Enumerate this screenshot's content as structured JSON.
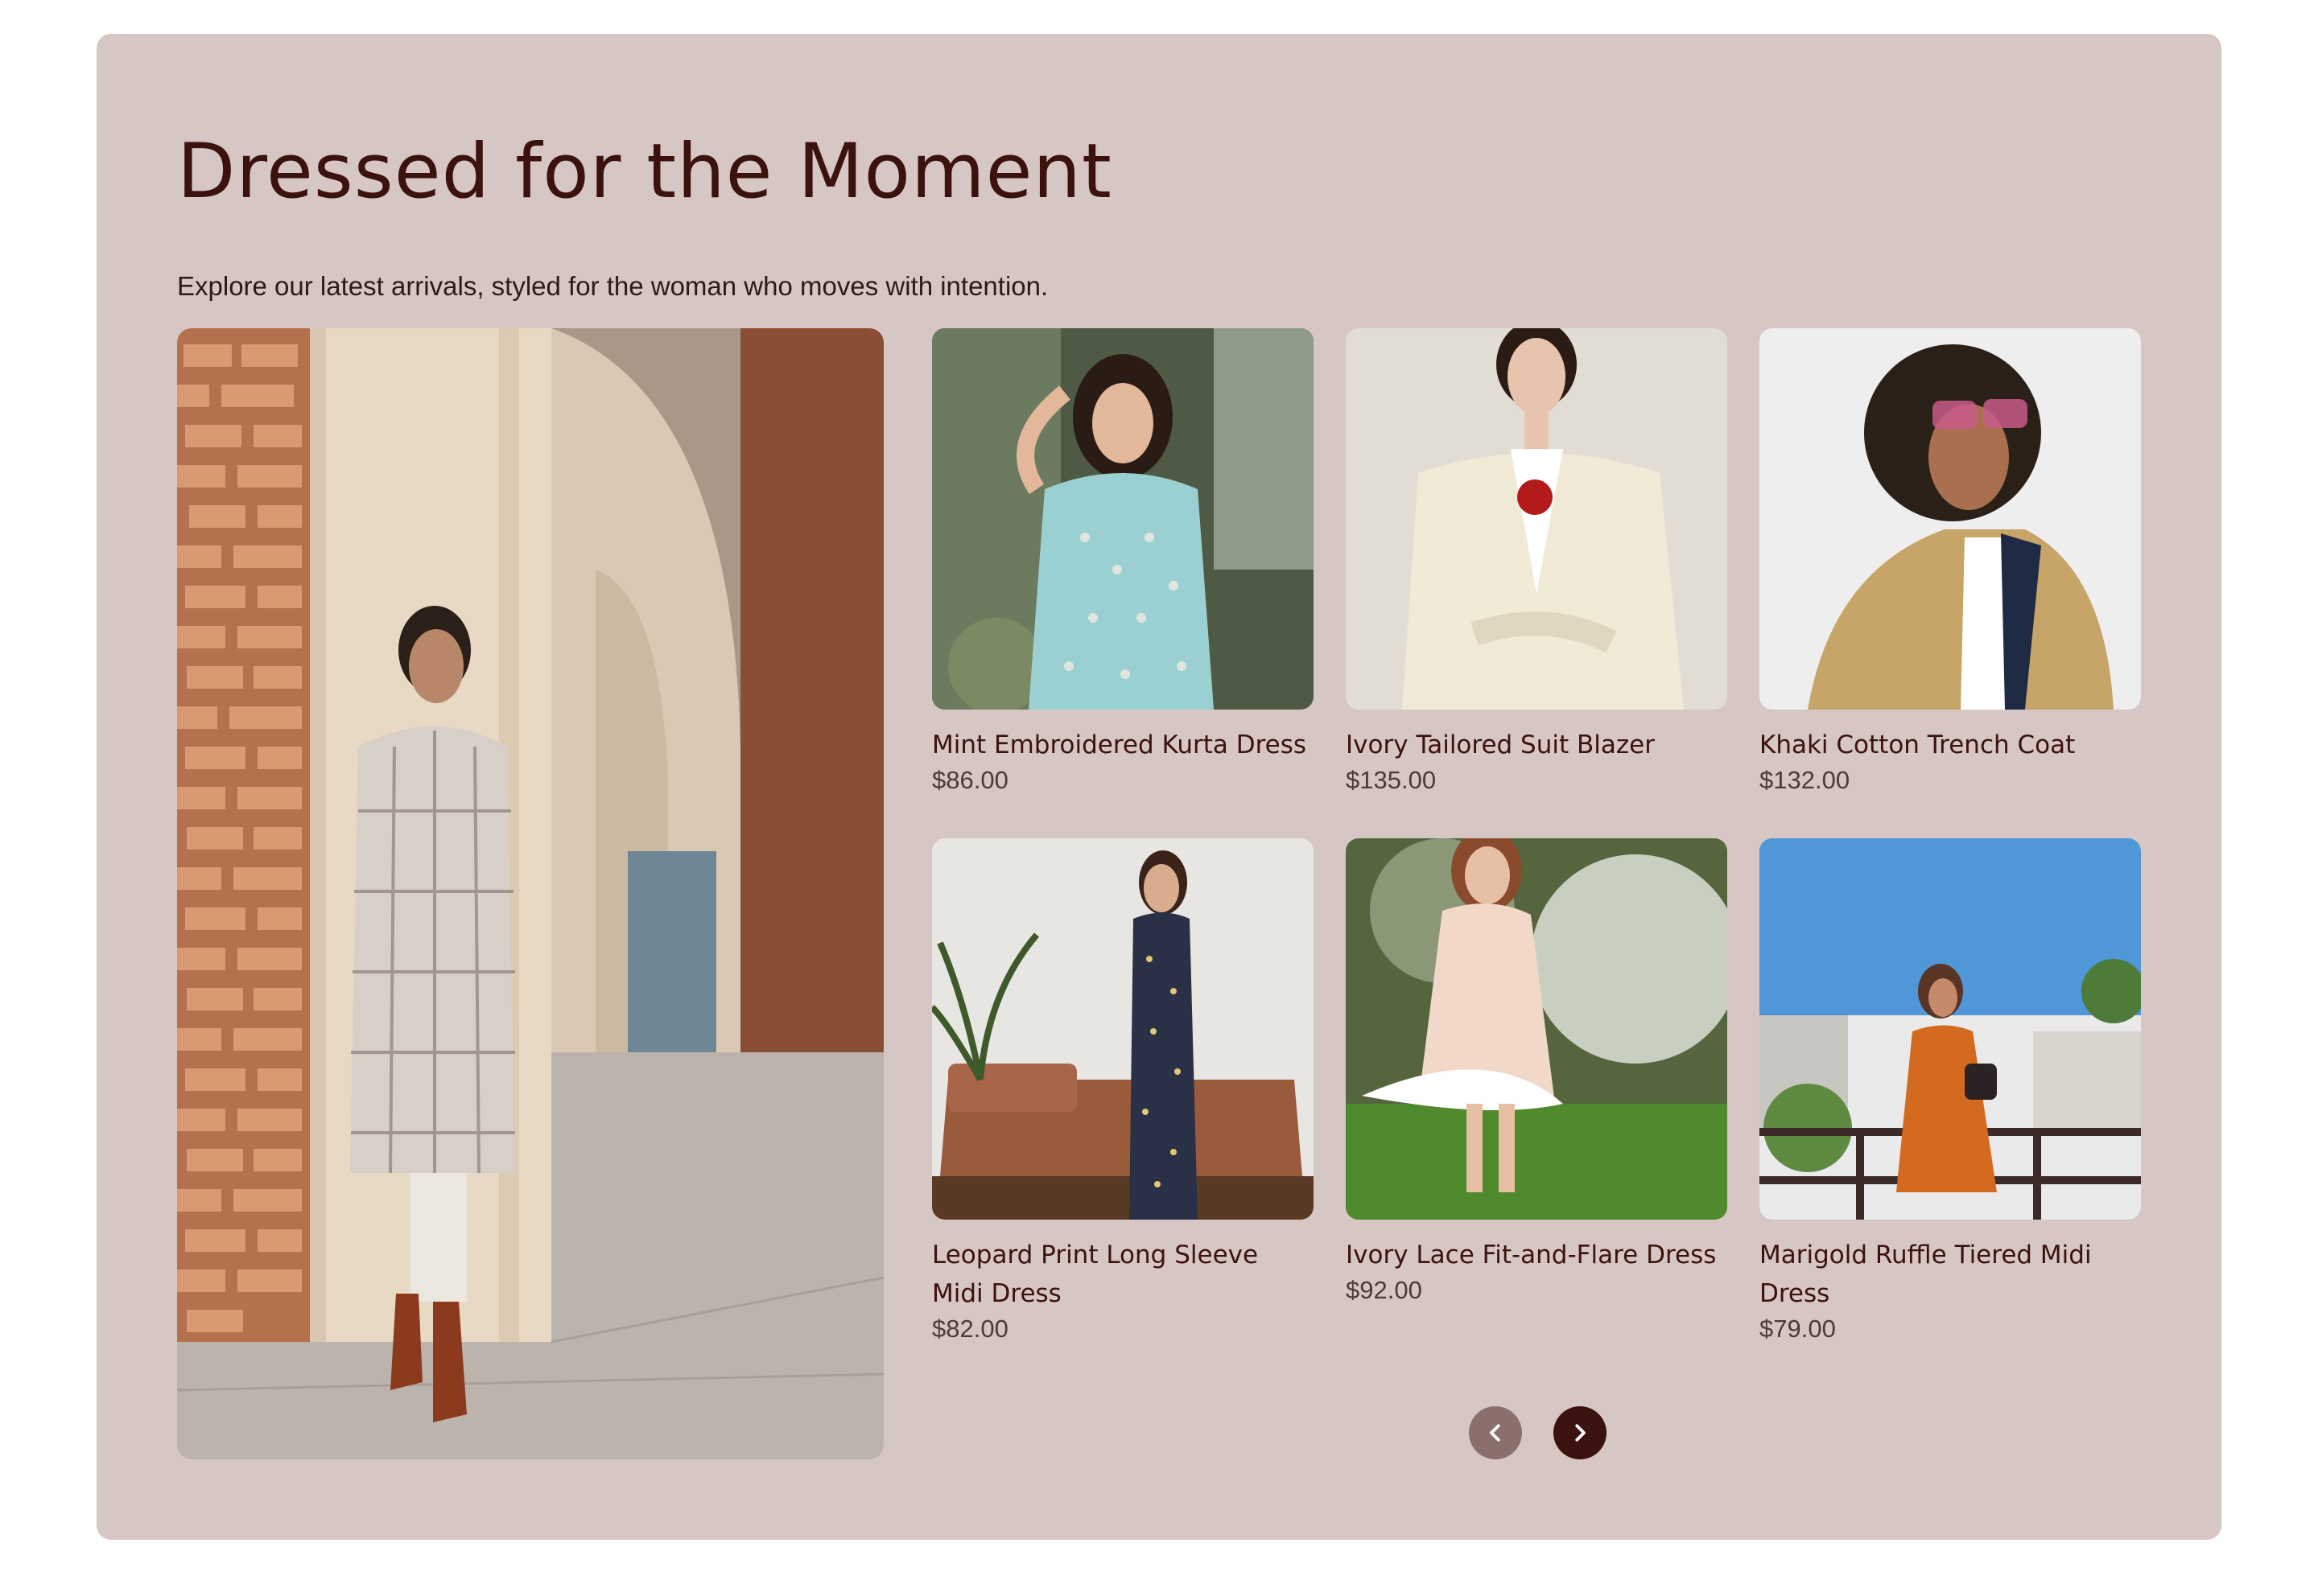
{
  "section": {
    "title": "Dressed for the Moment",
    "subtitle": "Explore our latest arrivals, styled for the woman who moves with intention."
  },
  "hero": {
    "icon": "featured-lookbook-photo"
  },
  "products": [
    {
      "name": "Mint Embroidered Kurta Dress",
      "price": "$86.00"
    },
    {
      "name": "Ivory Tailored Suit Blazer",
      "price": "$135.00"
    },
    {
      "name": "Khaki Cotton Trench Coat",
      "price": "$132.00"
    },
    {
      "name": "Leopard Print Long Sleeve Midi Dress",
      "price": "$82.00"
    },
    {
      "name": "Ivory Lace Fit-and-Flare Dress",
      "price": "$92.00"
    },
    {
      "name": "Marigold Ruffle Tiered Midi Dress",
      "price": "$79.00"
    }
  ],
  "carousel": {
    "prev_icon": "chevron-left-icon",
    "next_icon": "chevron-right-icon"
  },
  "colors": {
    "section_bg": "#d6c7c5",
    "title": "#3b120d",
    "next_button": "#3b120d",
    "prev_button": "#8a6f6c"
  }
}
